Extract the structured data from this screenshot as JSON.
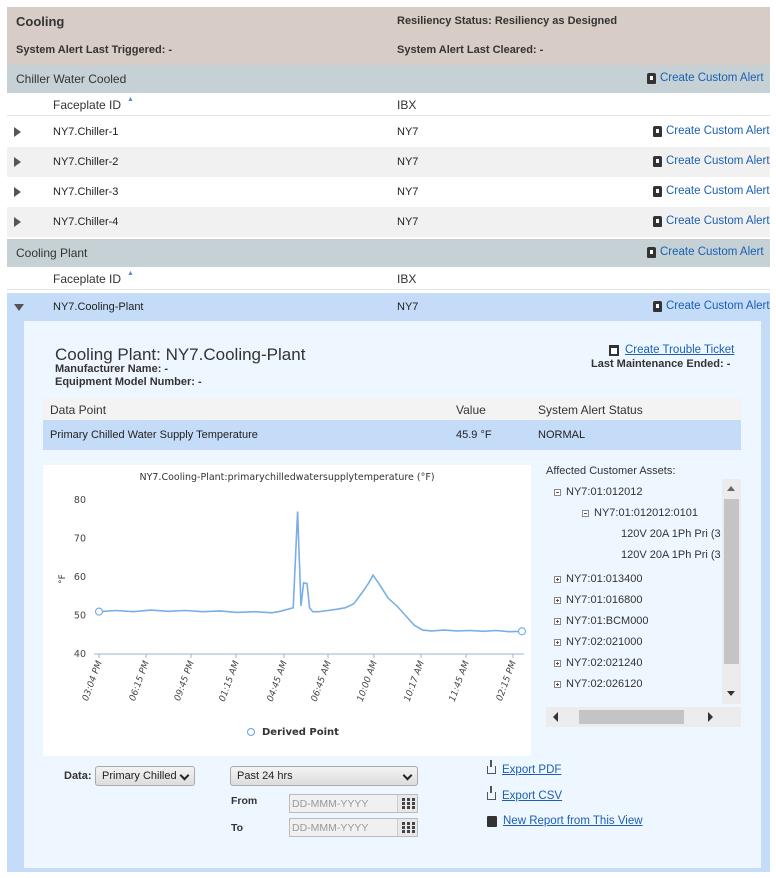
{
  "header": {
    "title": "Cooling",
    "resiliency": "Resiliency Status: Resiliency as Designed",
    "last_triggered": "System Alert Last Triggered: -",
    "last_cleared": "System Alert Last Cleared: -"
  },
  "groups": [
    {
      "title": "Chiller Water Cooled",
      "alert_label": "Create Custom Alert",
      "col_faceplate": "Faceplate ID",
      "col_ibx": "IBX",
      "rows": [
        {
          "name": "NY7.Chiller-1",
          "ibx": "NY7",
          "alert": "Create Custom Alert"
        },
        {
          "name": "NY7.Chiller-2",
          "ibx": "NY7",
          "alert": "Create Custom Alert"
        },
        {
          "name": "NY7.Chiller-3",
          "ibx": "NY7",
          "alert": "Create Custom Alert"
        },
        {
          "name": "NY7.Chiller-4",
          "ibx": "NY7",
          "alert": "Create Custom Alert"
        }
      ]
    },
    {
      "title": "Cooling Plant",
      "alert_label": "Create Custom Alert",
      "col_faceplate": "Faceplate ID",
      "col_ibx": "IBX",
      "rows": [
        {
          "name": "NY7.Cooling-Plant",
          "ibx": "NY7",
          "alert": "Create Custom Alert"
        }
      ]
    }
  ],
  "detail": {
    "title": "Cooling Plant: NY7.Cooling-Plant",
    "manufacturer": "Manufacturer Name: -",
    "model": "Equipment Model Number: -",
    "trouble_ticket": "Create Trouble Ticket",
    "last_maintenance": "Last Maintenance Ended: -",
    "table_headers": {
      "data_point": "Data Point",
      "value": "Value",
      "status": "System Alert Status"
    },
    "table_row": {
      "data_point": "Primary Chilled Water Supply Temperature",
      "value": "45.9 °F",
      "status": "NORMAL"
    },
    "assets_label": "Affected Customer Assets:",
    "assets": [
      {
        "label": "NY7:01:012012",
        "expander": "minus"
      },
      {
        "label": "NY7:01:012012:0101",
        "expander": "minus"
      },
      {
        "label": "120V 20A 1Ph Pri (3",
        "expander": "none"
      },
      {
        "label": "120V 20A 1Ph Pri (3",
        "expander": "none"
      },
      {
        "label": "NY7:01:013400",
        "expander": "plus"
      },
      {
        "label": "NY7:01:016800",
        "expander": "plus"
      },
      {
        "label": "NY7:01:BCM000",
        "expander": "plus"
      },
      {
        "label": "NY7:02:021000",
        "expander": "plus"
      },
      {
        "label": "NY7:02:021240",
        "expander": "plus"
      },
      {
        "label": "NY7:02:026120",
        "expander": "plus"
      }
    ],
    "controls": {
      "data_label": "Data:",
      "data_select": "Primary Chilled",
      "range_select": "Past 24 hrs",
      "from_label": "From",
      "to_label": "To",
      "date_placeholder": "DD-MMM-YYYY"
    },
    "exports": {
      "pdf": "Export PDF",
      "csv": "Export CSV",
      "report": "New Report from This View"
    }
  },
  "chart_data": {
    "type": "line",
    "title": "NY7.Cooling-Plant:primarychilledwatersupplytemperature (°F)",
    "ylabel": "°F",
    "xlabel": "",
    "ylim": [
      40,
      80
    ],
    "yticks": [
      40,
      50,
      60,
      70,
      80
    ],
    "xticks": [
      "03:04 PM",
      "06:15 PM",
      "09:45 PM",
      "01:15 AM",
      "04:45 AM",
      "06:45 AM",
      "10:00 AM",
      "10:17 AM",
      "11:45 AM",
      "02:15 PM"
    ],
    "legend": "Derived Point",
    "grid": false,
    "series": [
      {
        "color": "#7aaee6",
        "points": [
          [
            0,
            51.0
          ],
          [
            0.4,
            51.3
          ],
          [
            0.8,
            51.0
          ],
          [
            1.2,
            51.4
          ],
          [
            1.6,
            51.1
          ],
          [
            2,
            51.3
          ],
          [
            2.4,
            51.0
          ],
          [
            2.8,
            51.2
          ],
          [
            3.2,
            50.8
          ],
          [
            3.6,
            51.0
          ],
          [
            4.0,
            50.7
          ],
          [
            4.2,
            51.1
          ],
          [
            4.5,
            52.0
          ],
          [
            4.6,
            77.0
          ],
          [
            4.68,
            52.5
          ],
          [
            4.74,
            58.5
          ],
          [
            4.82,
            58.3
          ],
          [
            4.88,
            52.0
          ],
          [
            4.95,
            51.0
          ],
          [
            5.1,
            51.0
          ],
          [
            5.3,
            51.3
          ],
          [
            5.5,
            51.6
          ],
          [
            5.7,
            52.0
          ],
          [
            5.9,
            53.0
          ],
          [
            6.1,
            56.0
          ],
          [
            6.25,
            58.5
          ],
          [
            6.35,
            60.5
          ],
          [
            6.5,
            58.0
          ],
          [
            6.7,
            54.5
          ],
          [
            6.9,
            52.5
          ],
          [
            7.1,
            50.0
          ],
          [
            7.3,
            47.5
          ],
          [
            7.5,
            46.2
          ],
          [
            7.7,
            46.0
          ],
          [
            8.0,
            46.2
          ],
          [
            8.3,
            46.0
          ],
          [
            8.6,
            46.1
          ],
          [
            8.9,
            45.9
          ],
          [
            9.2,
            46.1
          ],
          [
            9.5,
            45.8
          ],
          [
            9.8,
            45.9
          ]
        ]
      }
    ]
  }
}
